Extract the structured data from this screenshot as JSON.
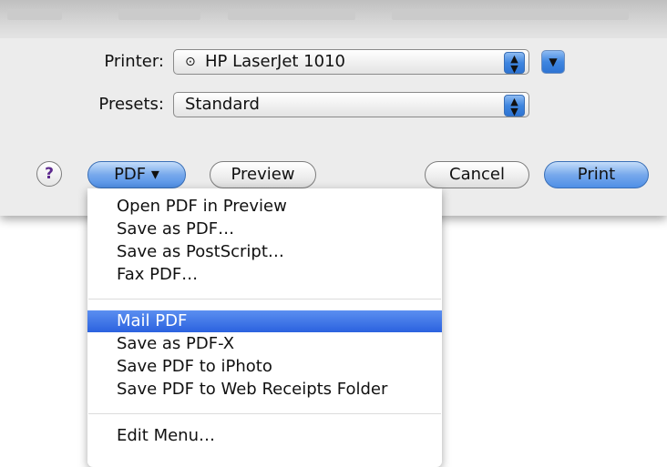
{
  "dialog": {
    "printer": {
      "label": "Printer:",
      "value": "HP LaserJet 1010",
      "status_glyph": "⊙"
    },
    "presets": {
      "label": "Presets:",
      "value": "Standard"
    },
    "buttons": {
      "help": "?",
      "pdf": "PDF ▾",
      "preview": "Preview",
      "cancel": "Cancel",
      "print": "Print"
    }
  },
  "pdf_menu": {
    "items": [
      {
        "label": "Open PDF in Preview",
        "selected": false
      },
      {
        "label": "Save as PDF…",
        "selected": false
      },
      {
        "label": "Save as PostScript…",
        "selected": false
      },
      {
        "label": "Fax PDF…",
        "selected": false
      },
      {
        "label": "Mail PDF",
        "selected": true
      },
      {
        "label": "Save as PDF-X",
        "selected": false
      },
      {
        "label": "Save PDF to iPhoto",
        "selected": false
      },
      {
        "label": "Save PDF to Web Receipts Folder",
        "selected": false
      },
      {
        "label": "Edit Menu…",
        "selected": false
      }
    ]
  },
  "colors": {
    "accent": "#3f86e0",
    "selection": "#2b62df",
    "sheet_bg": "#ececec"
  }
}
